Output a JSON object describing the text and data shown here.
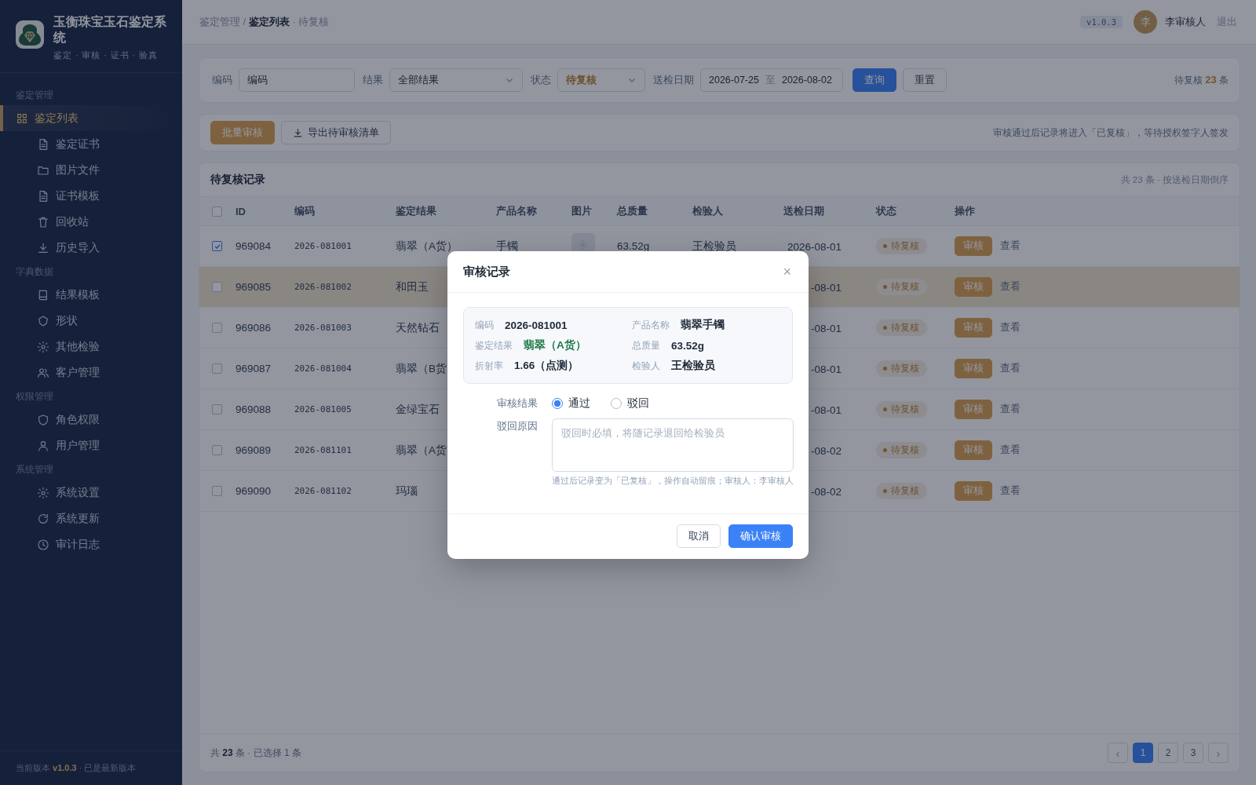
{
  "sidebar": {
    "brand": {
      "title": "玉衡珠宝玉石鉴定系统",
      "subtitle": "鉴定 · 审核 · 证书 · 验真"
    },
    "groups": [
      {
        "title": "鉴定管理",
        "items": [
          {
            "label": "鉴定列表",
            "selected": true
          },
          {
            "label": "鉴定证书",
            "selected": false
          },
          {
            "label": "图片文件",
            "selected": false
          },
          {
            "label": "证书模板",
            "selected": false
          },
          {
            "label": "回收站",
            "selected": false
          },
          {
            "label": "历史导入",
            "selected": false
          }
        ]
      },
      {
        "title": "字典数据",
        "items": [
          {
            "label": "结果模板",
            "selected": false
          },
          {
            "label": "形状",
            "selected": false
          },
          {
            "label": "其他检验",
            "selected": false
          },
          {
            "label": "客户管理",
            "selected": false
          }
        ]
      },
      {
        "title": "权限管理",
        "items": [
          {
            "label": "角色权限",
            "selected": false
          },
          {
            "label": "用户管理",
            "selected": false
          }
        ]
      },
      {
        "title": "系统管理",
        "items": [
          {
            "label": "系统设置",
            "selected": false
          },
          {
            "label": "系统更新",
            "selected": false
          },
          {
            "label": "审计日志",
            "selected": false
          }
        ]
      }
    ],
    "footer": "当前版本 **v1.0.3** · 已是最新版本"
  },
  "topbar": {
    "breadcrumb": "鉴定管理 / **鉴定列表** · 待复核",
    "version": "v1.0.3",
    "avatar": "李",
    "user": "李审核人",
    "logout": "退出"
  },
  "filters": {
    "fields": [
      {
        "kind": "input",
        "label": "编码",
        "value": "编码"
      },
      {
        "kind": "select",
        "label": "结果",
        "value": "全部结果",
        "active": false
      },
      {
        "kind": "select",
        "label": "状态",
        "value": "待复核",
        "active": true
      },
      {
        "kind": "daterange",
        "label": "送检日期",
        "start": "2026-07-25",
        "separator": "至",
        "end": "2026-08-02"
      }
    ],
    "buttons": [
      {
        "label": "查询",
        "kind": "primary"
      },
      {
        "label": "重置",
        "kind": "default"
      }
    ],
    "summary": "待复核 **23** 条"
  },
  "actions": {
    "buttons": [
      {
        "label": "批量审核",
        "kind": "gold"
      },
      {
        "label": "导出待审核清单",
        "kind": "export"
      }
    ],
    "note": "审核通过后记录将进入「已复核」，等待授权签字人签发"
  },
  "table": {
    "title": "待复核记录",
    "meta": "共 23 条 · 按送检日期倒序",
    "select_all": {
      "checked": false
    },
    "columns": [
      "ID",
      "编码",
      "鉴定结果",
      "产品名称",
      "图片",
      "总质量",
      "检验人",
      "送检日期",
      "状态",
      "操作"
    ],
    "rows": [
      {
        "checked": true,
        "highlighted": false,
        "id": "969084",
        "code": "2026-081001",
        "result": "翡翠（A货）",
        "product": "手镯",
        "image": true,
        "weight": "63.52g",
        "inspector": "王检验员",
        "date": "2026-08-01",
        "status": "待复核",
        "actions": [
          "审核",
          "查看"
        ]
      },
      {
        "checked": false,
        "highlighted": true,
        "id": "969085",
        "code": "2026-081002",
        "result": "和田玉",
        "date": "-08-01",
        "status": "待复核",
        "actions": [
          "审核",
          "查看"
        ]
      },
      {
        "checked": false,
        "highlighted": false,
        "id": "969086",
        "code": "2026-081003",
        "result": "天然钻石",
        "date": "-08-01",
        "status": "待复核",
        "actions": [
          "审核",
          "查看"
        ]
      },
      {
        "checked": false,
        "highlighted": false,
        "id": "969087",
        "code": "2026-081004",
        "result": "翡翠（B货",
        "date": "-08-01",
        "status": "待复核",
        "actions": [
          "审核",
          "查看"
        ]
      },
      {
        "checked": false,
        "highlighted": false,
        "id": "969088",
        "code": "2026-081005",
        "result": "金绿宝石",
        "date": "-08-01",
        "status": "待复核",
        "actions": [
          "审核",
          "查看"
        ]
      },
      {
        "checked": false,
        "highlighted": false,
        "id": "969089",
        "code": "2026-081101",
        "result": "翡翠（A货",
        "date": "-08-02",
        "status": "待复核",
        "actions": [
          "审核",
          "查看"
        ]
      },
      {
        "checked": false,
        "highlighted": false,
        "id": "969090",
        "code": "2026-081102",
        "result": "玛瑙",
        "date": "-08-02",
        "status": "待复核",
        "actions": [
          "审核",
          "查看"
        ]
      }
    ],
    "footer": "共 **23** 条 · 已选择 1 条",
    "pagination": [
      {
        "label": "‹",
        "kind": "arrow",
        "selected": false
      },
      {
        "label": "1",
        "kind": "page",
        "selected": true
      },
      {
        "label": "2",
        "kind": "page",
        "selected": false
      },
      {
        "label": "3",
        "kind": "page",
        "selected": false
      },
      {
        "label": "›",
        "kind": "arrow",
        "selected": false
      }
    ]
  },
  "modal": {
    "title": "审核记录",
    "close": "×",
    "info": [
      {
        "label": "编码",
        "value": "2026-081001",
        "positive": false
      },
      {
        "label": "产品名称",
        "value": "翡翠手镯",
        "positive": false
      },
      {
        "label": "鉴定结果",
        "value": "翡翠（A货）",
        "positive": true
      },
      {
        "label": "总质量",
        "value": "63.52g",
        "positive": false
      },
      {
        "label": "折射率",
        "value": "1.66（点测）",
        "positive": false
      },
      {
        "label": "检验人",
        "value": "王检验员",
        "positive": false
      }
    ],
    "decision": {
      "label": "审核结果",
      "options": [
        {
          "label": "通过",
          "selected": true
        },
        {
          "label": "驳回",
          "selected": false
        }
      ]
    },
    "reason": {
      "label": "驳回原因",
      "placeholder": "驳回时必填，将随记录退回给检验员"
    },
    "hint": "通过后记录变为「已复核」，操作自动留痕；审核人：李审核人",
    "buttons": [
      {
        "label": "取消",
        "kind": "default"
      },
      {
        "label": "确认审核",
        "kind": "primary"
      }
    ]
  }
}
